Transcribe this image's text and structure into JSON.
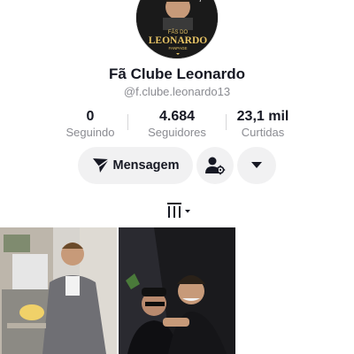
{
  "profile": {
    "display_name": "Fã Clube Leonardo",
    "username": "@f.clube.leonardo13",
    "avatar_text_top": "FÃS DO",
    "avatar_text_main": "LEONARDO",
    "avatar_text_bottom": "FANPAGE"
  },
  "stats": [
    {
      "value": "0",
      "label": "Seguindo"
    },
    {
      "value": "4.684",
      "label": "Seguidores"
    },
    {
      "value": "23,1 mil",
      "label": "Curtidas"
    }
  ],
  "actions": {
    "message_label": "Mensagem",
    "message_icon": "send-icon",
    "add_friend_icon": "person-gear-icon",
    "more_icon": "dropdown-arrow-icon"
  },
  "tabs": {
    "videos_icon": "grid-bars-icon"
  },
  "videos": [
    {
      "description": "man in suit in kitchen"
    },
    {
      "description": "two men smiling, one in cap"
    }
  ]
}
